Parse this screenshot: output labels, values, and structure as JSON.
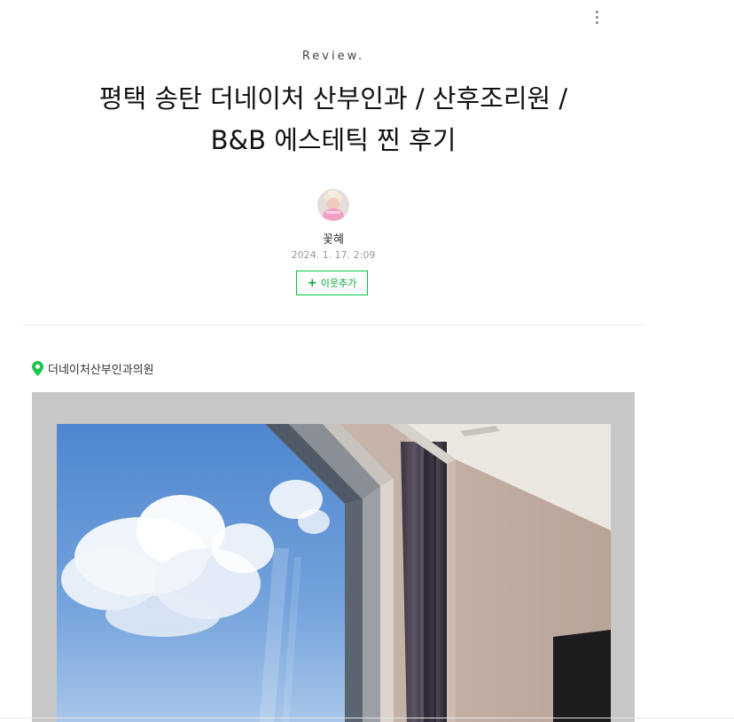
{
  "post": {
    "category": "Review.",
    "title_line1": "평택 송탄 더네이처 산부인과 / 산후조리원 /",
    "title_line2": "B&B 에스테틱 찐 후기",
    "author": "꽃혜",
    "date": "2024. 1. 17. 2:09",
    "add_neighbor_label": "이웃추가",
    "place_name": "더네이처산부인과의원"
  },
  "icons": {
    "more": "more-vertical-icon",
    "place": "map-pin-icon",
    "plus": "plus-icon"
  },
  "colors": {
    "accent_green": "#00c73c",
    "pin_green": "#1ec44e",
    "photo_frame": "#c7c7c7"
  }
}
